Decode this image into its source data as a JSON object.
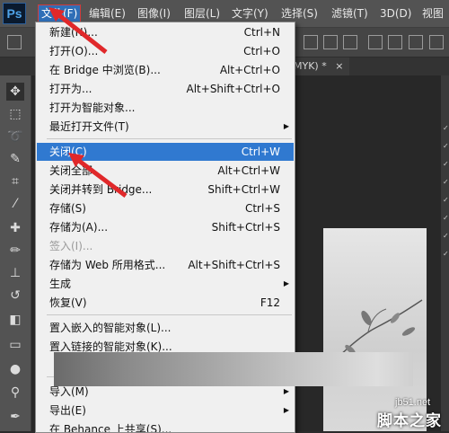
{
  "app": {
    "logo": "Ps"
  },
  "menubar": {
    "items": [
      {
        "label": "文件(F)",
        "active": true
      },
      {
        "label": "编辑(E)"
      },
      {
        "label": "图像(I)"
      },
      {
        "label": "图层(L)"
      },
      {
        "label": "文字(Y)"
      },
      {
        "label": "选择(S)"
      },
      {
        "label": "滤镜(T)"
      },
      {
        "label": "3D(D)"
      },
      {
        "label": "视图"
      }
    ]
  },
  "document": {
    "tab_title": "MYK) *",
    "close_glyph": "×"
  },
  "file_menu": {
    "items": [
      {
        "label": "新建(N)...",
        "shortcut": "Ctrl+N"
      },
      {
        "label": "打开(O)...",
        "shortcut": "Ctrl+O"
      },
      {
        "label": "在 Bridge 中浏览(B)...",
        "shortcut": "Alt+Ctrl+O"
      },
      {
        "label": "打开为...",
        "shortcut": "Alt+Shift+Ctrl+O"
      },
      {
        "label": "打开为智能对象..."
      },
      {
        "label": "最近打开文件(T)",
        "submenu": true
      },
      {
        "label": "关闭(C)",
        "shortcut": "Ctrl+W",
        "highlighted": true
      },
      {
        "label": "关闭全部",
        "shortcut": "Alt+Ctrl+W"
      },
      {
        "label": "关闭并转到 Bridge...",
        "shortcut": "Shift+Ctrl+W"
      },
      {
        "label": "存储(S)",
        "shortcut": "Ctrl+S"
      },
      {
        "label": "存储为(A)...",
        "shortcut": "Shift+Ctrl+S"
      },
      {
        "label": "签入(I)...",
        "disabled": true
      },
      {
        "label": "存储为 Web 所用格式...",
        "shortcut": "Alt+Shift+Ctrl+S"
      },
      {
        "label": "生成",
        "submenu": true
      },
      {
        "label": "恢复(V)",
        "shortcut": "F12"
      },
      {
        "label": "置入嵌入的智能对象(L)..."
      },
      {
        "label": "置入链接的智能对象(K)..."
      },
      {
        "label": "导入(M)",
        "submenu": true
      },
      {
        "label": "导出(E)",
        "submenu": true
      },
      {
        "label": "在 Behance 上共享(S)..."
      }
    ]
  },
  "watermark": {
    "line1": "jb51.net",
    "line2": "脚本之家"
  },
  "colors": {
    "accent": "#3079d0",
    "menubar": "#535353",
    "arrow": "#e0282a"
  },
  "tools": [
    "move-tool",
    "marquee-tool",
    "lasso-tool",
    "quick-select-tool",
    "crop-tool",
    "eyedropper-tool",
    "healing-tool",
    "brush-tool",
    "stamp-tool",
    "history-brush-tool",
    "eraser-tool",
    "gradient-tool",
    "blur-tool",
    "dodge-tool",
    "pen-tool"
  ]
}
